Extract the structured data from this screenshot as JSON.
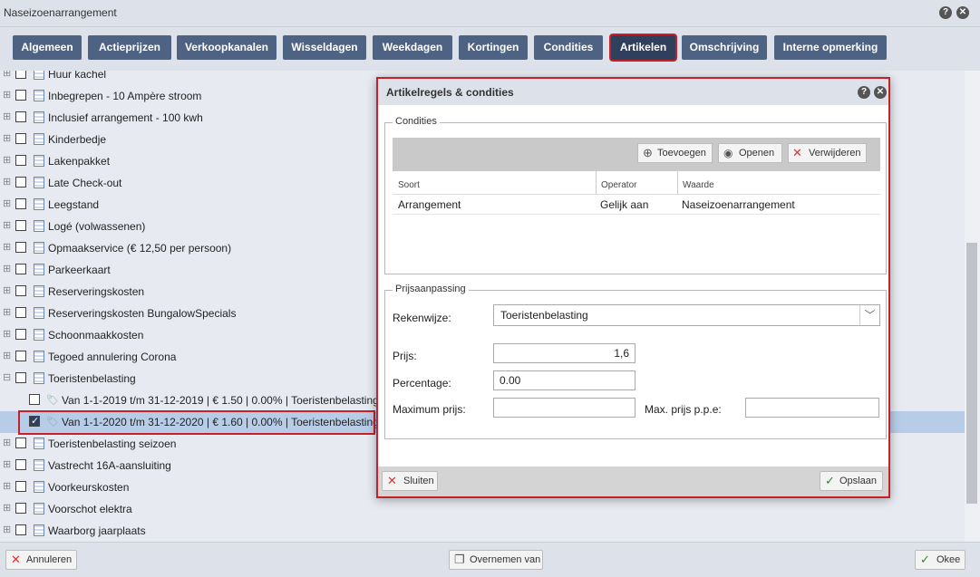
{
  "window": {
    "title": "Naseizoenarrangement"
  },
  "tabs": [
    {
      "label": "Algemeen"
    },
    {
      "label": "Actieprijzen"
    },
    {
      "label": "Verkoopkanalen"
    },
    {
      "label": "Wisseldagen"
    },
    {
      "label": "Weekdagen"
    },
    {
      "label": "Kortingen"
    },
    {
      "label": "Condities"
    },
    {
      "label": "Artikelen"
    },
    {
      "label": "Omschrijving"
    },
    {
      "label": "Interne opmerking"
    }
  ],
  "tree": {
    "items": [
      {
        "label": "Huur kachel"
      },
      {
        "label": "Inbegrepen - 10 Ampère stroom"
      },
      {
        "label": "Inclusief arrangement - 100 kwh"
      },
      {
        "label": "Kinderbedje"
      },
      {
        "label": "Lakenpakket"
      },
      {
        "label": "Late Check-out"
      },
      {
        "label": "Leegstand"
      },
      {
        "label": "Logé (volwassenen)"
      },
      {
        "label": "Opmaakservice (€ 12,50 per persoon)"
      },
      {
        "label": "Parkeerkaart"
      },
      {
        "label": "Reserveringskosten"
      },
      {
        "label": "Reserveringskosten BungalowSpecials"
      },
      {
        "label": "Schoonmaakkosten"
      },
      {
        "label": "Tegoed annulering Corona"
      },
      {
        "label": "Toeristenbelasting"
      },
      {
        "label": "Van 1-1-2019 t/m 31-12-2019 | € 1.50 | 0.00% | Toeristenbelasting"
      },
      {
        "label": "Van 1-1-2020 t/m 31-12-2020 | € 1.60 | 0.00% | Toeristenbelasting"
      },
      {
        "label": "Toeristenbelasting seizoen"
      },
      {
        "label": "Vastrecht 16A-aansluiting"
      },
      {
        "label": "Voorkeurskosten"
      },
      {
        "label": "Voorschot elektra"
      },
      {
        "label": "Waarborg jaarplaats"
      }
    ]
  },
  "footer": {
    "cancel_label": "Annuleren",
    "copy_label": "Overnemen van",
    "ok_label": "Okee"
  },
  "dialog": {
    "title": "Artikelregels & condities",
    "condities": {
      "legend": "Condities",
      "add_label": "Toevoegen",
      "open_label": "Openen",
      "delete_label": "Verwijderen",
      "columns": [
        "Soort",
        "Operator",
        "Waarde"
      ],
      "rows": [
        [
          "Arrangement",
          "Gelijk aan",
          "Naseizoenarrangement"
        ]
      ]
    },
    "prijs": {
      "legend": "Prijsaanpassing",
      "rekenwijze_label": "Rekenwijze:",
      "rekenwijze_value": "Toeristenbelasting",
      "prijs_label": "Prijs:",
      "prijs_value": "1,6",
      "percentage_label": "Percentage:",
      "percentage_value": "0.00",
      "max_label": "Maximum prijs:",
      "max_value": "",
      "max_ppe_label": "Max. prijs p.p.e:",
      "max_ppe_value": ""
    },
    "close_label": "Sluiten",
    "save_label": "Opslaan"
  }
}
